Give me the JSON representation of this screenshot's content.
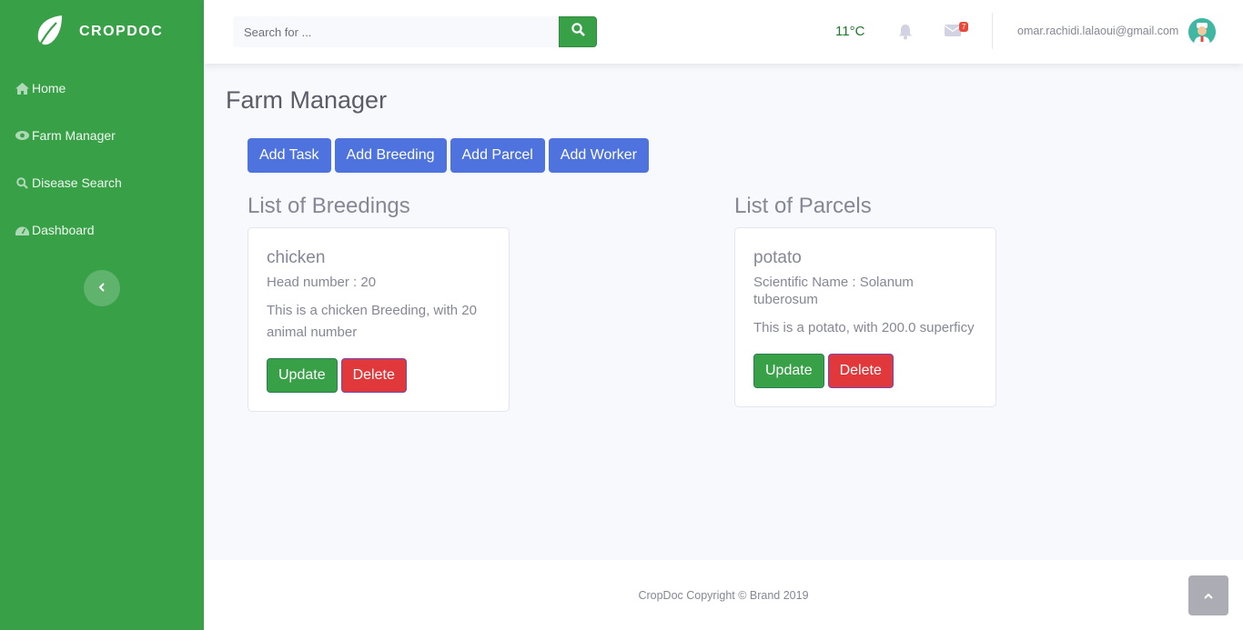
{
  "brand": {
    "name": "CROPDOC",
    "logo_icon": "leaf-icon"
  },
  "sidebar": {
    "items": [
      {
        "label": "Home",
        "icon": "home-icon"
      },
      {
        "label": "Farm Manager",
        "icon": "eye-icon"
      },
      {
        "label": "Disease Search",
        "icon": "search-icon"
      },
      {
        "label": "Dashboard",
        "icon": "tachometer-icon"
      }
    ],
    "toggle_icon": "chevron-left-icon"
  },
  "topbar": {
    "search": {
      "placeholder": "Search for ...",
      "value": ""
    },
    "temperature": "11°C",
    "messages_badge": "7",
    "user_email": "omar.rachidi.lalaoui@gmail.com"
  },
  "main": {
    "title": "Farm Manager",
    "actions": [
      "Add Task",
      "Add Breeding",
      "Add Parcel",
      "Add Worker"
    ],
    "breedings": {
      "title": "List of Breedings",
      "cards": [
        {
          "name": "chicken",
          "detail": "Head number : 20",
          "text": "This is a chicken Breeding, with 20 animal number",
          "update": "Update",
          "delete": "Delete"
        }
      ]
    },
    "parcels": {
      "title": "List of Parcels",
      "cards": [
        {
          "name": "potato",
          "detail": "Scientific Name : Solanum tuberosum",
          "text": "This is a potato, with 200.0 superficy",
          "update": "Update",
          "delete": "Delete"
        }
      ]
    }
  },
  "footer": {
    "text": "CropDoc Copyright © Brand 2019"
  },
  "colors": {
    "sidebar": "#38a148",
    "primary": "#4e73df",
    "success": "#38a148",
    "danger": "#e0383b"
  }
}
